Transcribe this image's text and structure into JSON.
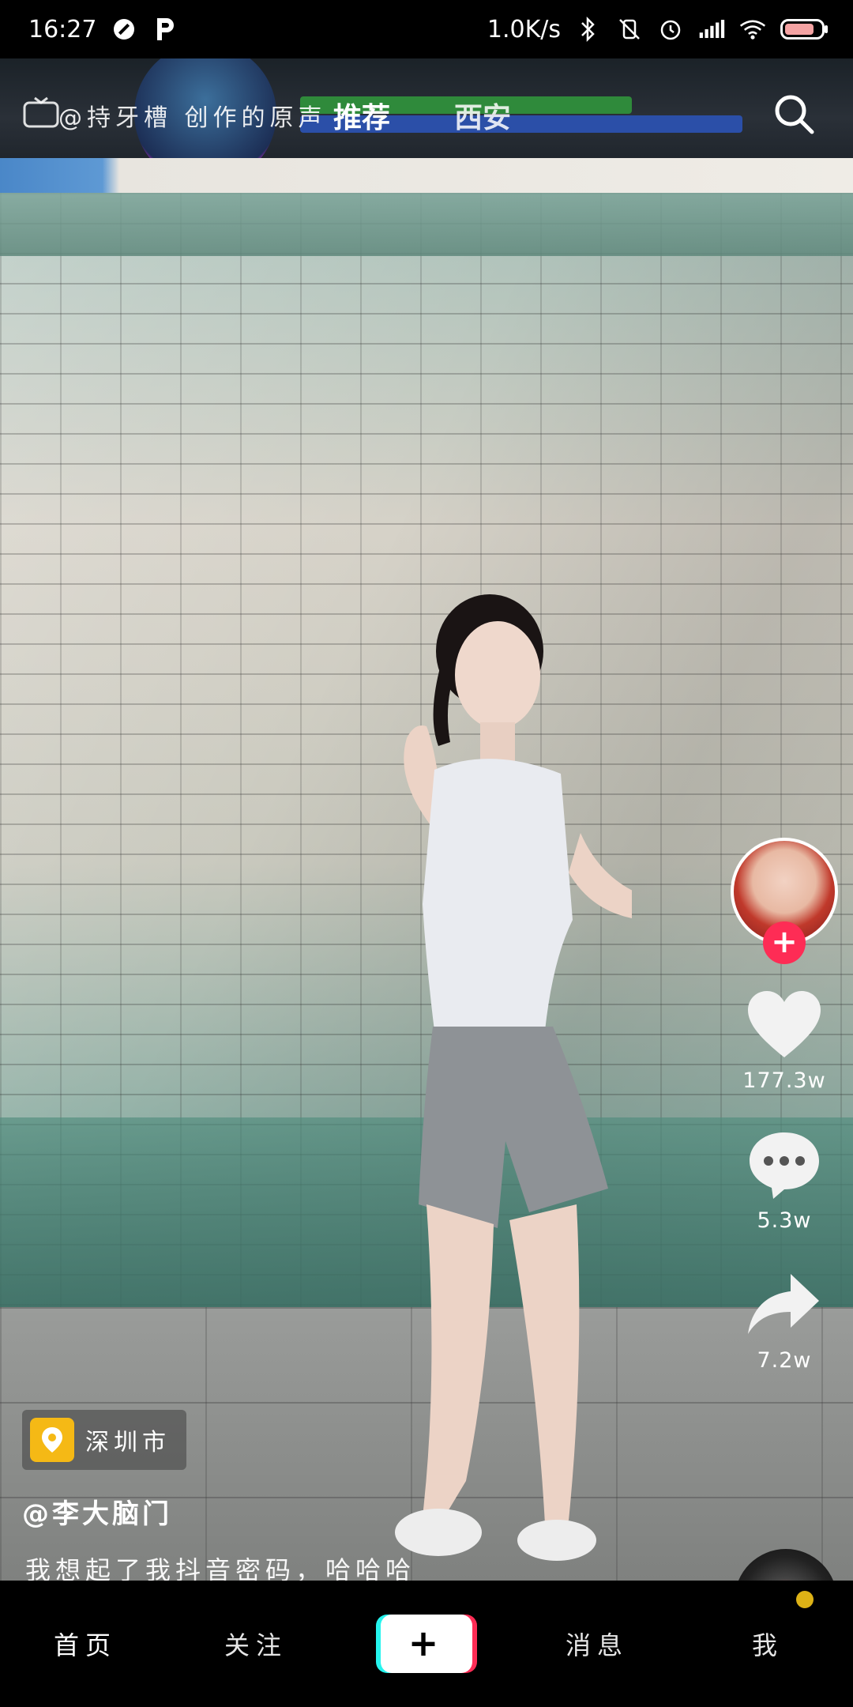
{
  "status_bar": {
    "time": "16:27",
    "net_speed": "1.0K/s"
  },
  "top_bar": {
    "music": "@持牙槽 创作的原声",
    "tab_recommend": "推荐",
    "tab_city": "西安"
  },
  "actions": {
    "likes": "177.3w",
    "comments": "5.3w",
    "shares": "7.2w"
  },
  "video_info": {
    "location": "深圳市",
    "author": "@李大脑门",
    "caption": "我想起了我抖音密码，哈哈哈"
  },
  "bottom_nav": {
    "home": "首页",
    "follow": "关注",
    "create": "+",
    "messages": "消息",
    "me": "我"
  },
  "colors": {
    "accent_red": "#fe2c55",
    "accent_cyan": "#25f4ee",
    "location_pin": "#f5b915",
    "notification_dot": "#f5c518"
  }
}
